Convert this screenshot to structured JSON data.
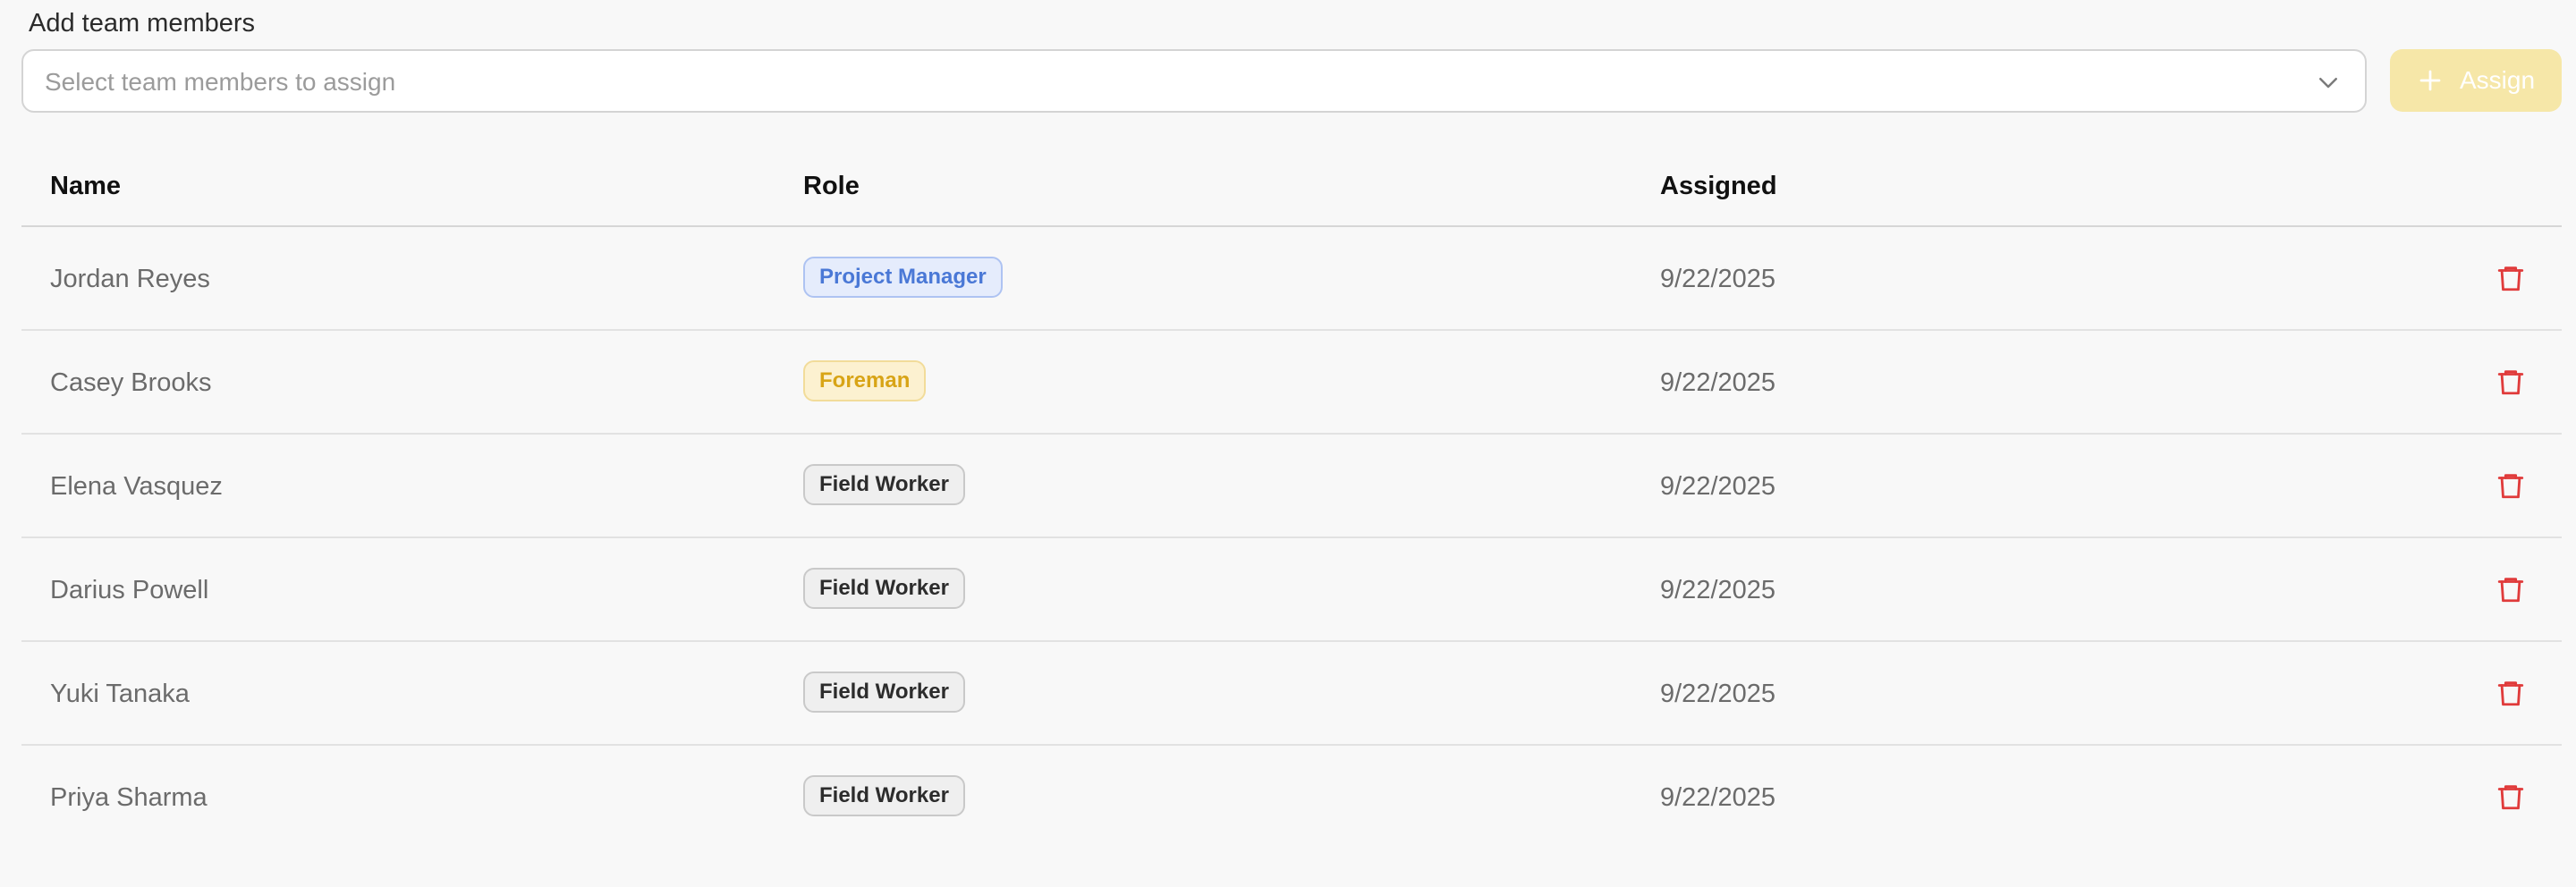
{
  "form": {
    "label": "Add team members",
    "select_placeholder": "Select team members to assign",
    "assign_label": "Assign"
  },
  "table": {
    "headers": {
      "name": "Name",
      "role": "Role",
      "assigned": "Assigned"
    },
    "rows": [
      {
        "name": "Jordan Reyes",
        "role": "Project Manager",
        "role_style": "pm",
        "assigned": "9/22/2025"
      },
      {
        "name": "Casey Brooks",
        "role": "Foreman",
        "role_style": "fm",
        "assigned": "9/22/2025"
      },
      {
        "name": "Elena Vasquez",
        "role": "Field Worker",
        "role_style": "fw",
        "assigned": "9/22/2025"
      },
      {
        "name": "Darius Powell",
        "role": "Field Worker",
        "role_style": "fw",
        "assigned": "9/22/2025"
      },
      {
        "name": "Yuki Tanaka",
        "role": "Field Worker",
        "role_style": "fw",
        "assigned": "9/22/2025"
      },
      {
        "name": "Priya Sharma",
        "role": "Field Worker",
        "role_style": "fw",
        "assigned": "9/22/2025"
      }
    ]
  },
  "icons": {
    "select": "chevron-down-icon",
    "assign": "plus-icon",
    "row_action": "trash-icon"
  },
  "colors": {
    "accent": "#f6e7a8",
    "danger": "#e03b3b",
    "pm": "#4a78d6",
    "foreman": "#d8a416"
  }
}
